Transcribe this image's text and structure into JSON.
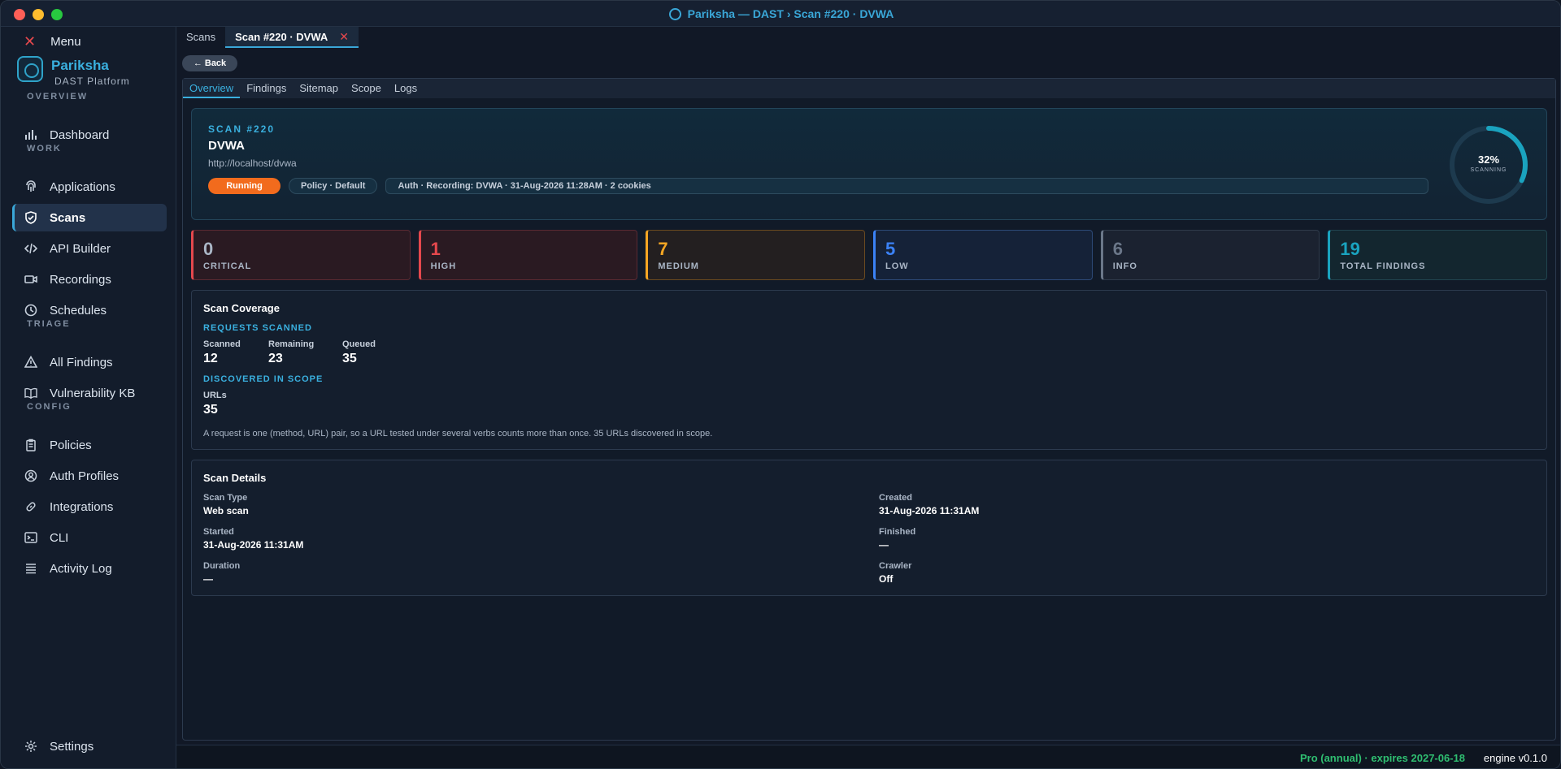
{
  "window": {
    "title": "Pariksha — DAST  ›  Scan #220 · DVWA"
  },
  "sidebar": {
    "menu_label": "Menu",
    "brand_name": "Pariksha",
    "brand_sub": "DAST Platform",
    "sections": {
      "overview": "OVERVIEW",
      "work": "WORK",
      "triage": "TRIAGE",
      "config": "CONFIG"
    },
    "items": {
      "dashboard": "Dashboard",
      "applications": "Applications",
      "scans": "Scans",
      "api_builder": "API Builder",
      "recordings": "Recordings",
      "schedules": "Schedules",
      "all_findings": "All Findings",
      "vulnerability_kb": "Vulnerability KB",
      "policies": "Policies",
      "auth_profiles": "Auth Profiles",
      "integrations": "Integrations",
      "cli": "CLI",
      "activity_log": "Activity Log",
      "settings": "Settings"
    },
    "active": "scans"
  },
  "tabs": {
    "scans": "Scans",
    "current": "Scan #220 · DVWA",
    "close_glyph": "✕"
  },
  "back_label": "← Back",
  "subtabs": [
    "Overview",
    "Findings",
    "Sitemap",
    "Scope",
    "Logs"
  ],
  "scan": {
    "kicker": "SCAN #220",
    "name": "DVWA",
    "url": "http://localhost/dvwa",
    "status": "Running",
    "policy": "Policy · Default",
    "auth": "Auth · Recording: DVWA  ·  31-Aug-2026 11:28AM  ·  2 cookies",
    "progress_pct": 32,
    "progress_text": "32%",
    "progress_label": "SCANNING"
  },
  "severity_cards": [
    {
      "key": "critical",
      "value": "0",
      "label": "CRITICAL"
    },
    {
      "key": "high",
      "value": "1",
      "label": "HIGH"
    },
    {
      "key": "medium",
      "value": "7",
      "label": "MEDIUM"
    },
    {
      "key": "low",
      "value": "5",
      "label": "LOW"
    },
    {
      "key": "info",
      "value": "6",
      "label": "INFO"
    },
    {
      "key": "total",
      "value": "19",
      "label": "TOTAL FINDINGS"
    }
  ],
  "coverage": {
    "title": "Scan Coverage",
    "requests_kicker": "REQUESTS SCANNED",
    "scanned_label": "Scanned",
    "scanned_value": "12",
    "remaining_label": "Remaining",
    "remaining_value": "23",
    "queued_label": "Queued",
    "queued_value": "35",
    "discovered_kicker": "DISCOVERED IN SCOPE",
    "urls_label": "URLs",
    "urls_value": "35",
    "note": "A request is one (method, URL) pair, so a URL tested under several verbs counts more than once. 35 URLs discovered in scope."
  },
  "details": {
    "title": "Scan Details",
    "scan_type_label": "Scan Type",
    "scan_type_value": "Web scan",
    "created_label": "Created",
    "created_value": "31-Aug-2026 11:31AM",
    "started_label": "Started",
    "started_value": "31-Aug-2026 11:31AM",
    "finished_label": "Finished",
    "finished_value": "—",
    "duration_label": "Duration",
    "duration_value": "—",
    "crawler_label": "Crawler",
    "crawler_value": "Off"
  },
  "statusbar": {
    "license": "Pro (annual) · expires 2027-06-18",
    "engine": "engine v0.1.0"
  },
  "colors": {
    "accent": "#3ab0df",
    "running": "#f26b1d",
    "critical": "#e5484d",
    "medium": "#f5a623",
    "low": "#3b82f6",
    "info": "#6b7789",
    "total": "#1aa3bf",
    "license": "#2fbf71"
  }
}
